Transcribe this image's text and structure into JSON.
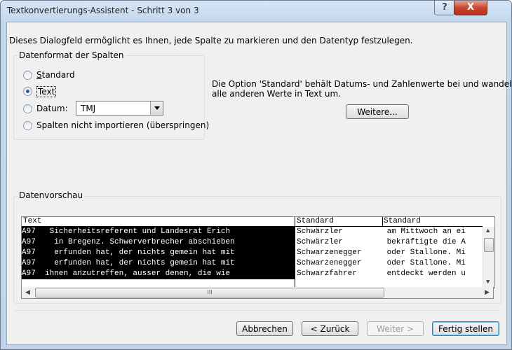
{
  "window": {
    "title": "Textkonvertierungs-Assistent - Schritt 3 von 3"
  },
  "titlebar": {
    "help_glyph": "?",
    "close_glyph": "X"
  },
  "intro": "Dieses Dialogfeld ermöglicht es Ihnen, jede Spalte zu markieren und den Datentyp festzulegen.",
  "format_group": {
    "title": "Datenformat der Spalten",
    "options": [
      {
        "label": "Standard",
        "selected": false
      },
      {
        "label": "Text",
        "selected": true
      },
      {
        "label": "Datum:",
        "selected": false
      },
      {
        "label": "Spalten nicht importieren (überspringen)",
        "selected": false
      }
    ],
    "date_format": "TMJ"
  },
  "info_text": {
    "line1": "Die Option 'Standard' behält Datums- und Zahlenwerte bei und wandelt",
    "line2": "alle anderen Werte in Text um."
  },
  "more_button": "Weitere...",
  "preview": {
    "title": "Datenvorschau",
    "columns": [
      {
        "header": "Text",
        "selected": true,
        "rows": [
          "A97   Sicherheitsreferent und Landesrat Erich",
          "A97    in Bregenz. Schwerverbrecher abschieben",
          "A97    erfunden hat, der nichts gemein hat mit",
          "A97    erfunden hat, der nichts gemein hat mit",
          "A97  ihnen anzutreffen, ausser denen, die wie"
        ]
      },
      {
        "header": "Standard",
        "selected": false,
        "rows": [
          "Schwärzler",
          "Schwärzler",
          "Schwarzenegger",
          "Schwarzenegger",
          "Schwarzfahrer"
        ]
      },
      {
        "header": "Standard",
        "selected": false,
        "rows": [
          " am Mittwoch an ei",
          " bekräftigte die A",
          " oder Stallone. Mi",
          " oder Stallone. Mi",
          " entdeckt werden u"
        ]
      }
    ],
    "hscroll_glyph": "III"
  },
  "buttons": {
    "cancel": "Abbrechen",
    "back": "< Zurück",
    "next": "Weiter >",
    "finish": "Fertig stellen"
  }
}
